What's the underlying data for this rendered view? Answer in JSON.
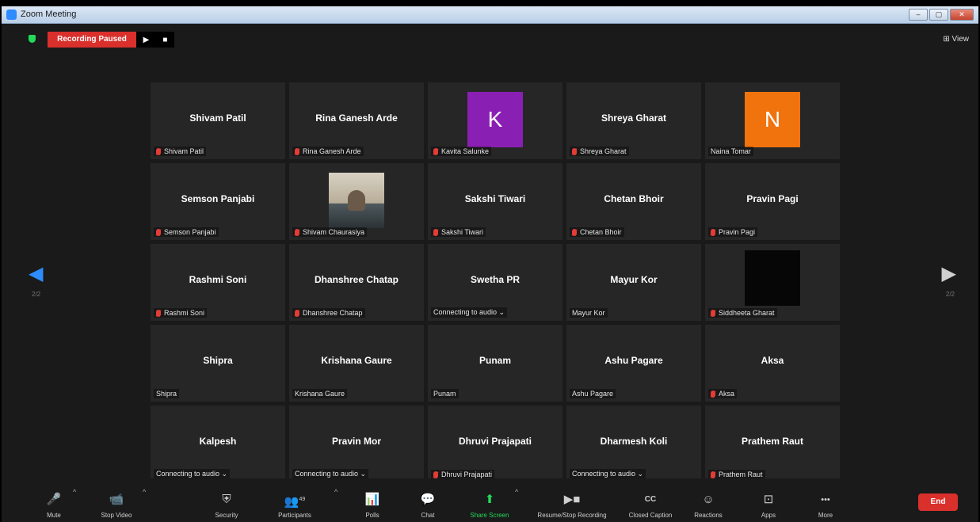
{
  "window": {
    "title": "Zoom Meeting",
    "controls": {
      "minimize": "–",
      "maximize": "▢",
      "close": "✕"
    }
  },
  "header": {
    "recording_status": "Recording Paused",
    "resume_glyph": "▶",
    "stop_glyph": "■",
    "view_label": "⊞ View"
  },
  "navigation": {
    "prev_glyph": "◀",
    "next_glyph": "▶",
    "prev_page": "2/2",
    "next_page": "2/2"
  },
  "participants": [
    {
      "display": "Shivam Patil",
      "label": "Shivam Patil",
      "muted": true,
      "kind": "name"
    },
    {
      "display": "Rina Ganesh Arde",
      "label": "Rina Ganesh Arde",
      "muted": true,
      "kind": "name"
    },
    {
      "display": "K",
      "label": "Kavita Salunke",
      "muted": true,
      "kind": "avatar",
      "color": "#8a1fb3"
    },
    {
      "display": "Shreya Gharat",
      "label": "Shreya Gharat",
      "muted": true,
      "kind": "name"
    },
    {
      "display": "N",
      "label": "Naina Tomar",
      "muted": false,
      "kind": "avatar",
      "color": "#f0730e"
    },
    {
      "display": "Semson Panjabi",
      "label": "Semson Panjabi",
      "muted": true,
      "kind": "name"
    },
    {
      "display": "",
      "label": "Shivam Chaurasiya",
      "muted": true,
      "kind": "photo"
    },
    {
      "display": "Sakshi Tiwari",
      "label": "Sakshi Tiwari",
      "muted": true,
      "kind": "name"
    },
    {
      "display": "Chetan Bhoir",
      "label": "Chetan Bhoir",
      "muted": true,
      "kind": "name"
    },
    {
      "display": "Pravin Pagi",
      "label": "Pravin Pagi",
      "muted": true,
      "kind": "name"
    },
    {
      "display": "Rashmi Soni",
      "label": "Rashmi Soni",
      "muted": true,
      "kind": "name"
    },
    {
      "display": "Dhanshree Chatap",
      "label": "Dhanshree Chatap",
      "muted": true,
      "kind": "name"
    },
    {
      "display": "Swetha PR",
      "label": "Connecting to audio ⌄",
      "muted": false,
      "kind": "name"
    },
    {
      "display": "Mayur Kor",
      "label": "Mayur Kor",
      "muted": false,
      "kind": "name"
    },
    {
      "display": "",
      "label": "Siddheeta Gharat",
      "muted": true,
      "kind": "black"
    },
    {
      "display": "Shipra",
      "label": "Shipra",
      "muted": false,
      "kind": "name"
    },
    {
      "display": "Krishana Gaure",
      "label": "Krishana Gaure",
      "muted": false,
      "kind": "name"
    },
    {
      "display": "Punam",
      "label": "Punam",
      "muted": false,
      "kind": "name"
    },
    {
      "display": "Ashu Pagare",
      "label": "Ashu Pagare",
      "muted": false,
      "kind": "name"
    },
    {
      "display": "Aksa",
      "label": "Aksa",
      "muted": true,
      "kind": "name"
    },
    {
      "display": "Kalpesh",
      "label": "Connecting to audio ⌄",
      "muted": false,
      "kind": "name"
    },
    {
      "display": "Pravin Mor",
      "label": "Connecting to audio ⌄",
      "muted": false,
      "kind": "name"
    },
    {
      "display": "Dhruvi Prajapati",
      "label": "Dhruvi Prajapati",
      "muted": true,
      "kind": "name"
    },
    {
      "display": "Dharmesh Koli",
      "label": "Connecting to audio ⌄",
      "muted": false,
      "kind": "name"
    },
    {
      "display": "Prathem Raut",
      "label": "Prathem Raut",
      "muted": true,
      "kind": "name"
    }
  ],
  "toolbar": {
    "mute": {
      "label": "Mute",
      "icon": "🎤"
    },
    "stop_video": {
      "label": "Stop Video",
      "icon": "📹"
    },
    "security": {
      "label": "Security",
      "icon": "⛨"
    },
    "participants": {
      "label": "Participants",
      "icon": "👥",
      "count": "49"
    },
    "polls": {
      "label": "Polls",
      "icon": "📊"
    },
    "chat": {
      "label": "Chat",
      "icon": "💬"
    },
    "share_screen": {
      "label": "Share Screen",
      "icon": "⬆"
    },
    "recording": {
      "label": "Resume/Stop Recording",
      "icon": "▶■"
    },
    "closed_caption": {
      "label": "Closed Caption",
      "icon": "CC"
    },
    "reactions": {
      "label": "Reactions",
      "icon": "☺"
    },
    "apps": {
      "label": "Apps",
      "icon": "⊡"
    },
    "more": {
      "label": "More",
      "icon": "•••"
    },
    "end": {
      "label": "End"
    },
    "caret": "^"
  },
  "colors": {
    "accent_blue": "#2d8cff",
    "recording_red": "#d9302c",
    "share_green": "#23d959",
    "tile_bg": "#262626"
  }
}
